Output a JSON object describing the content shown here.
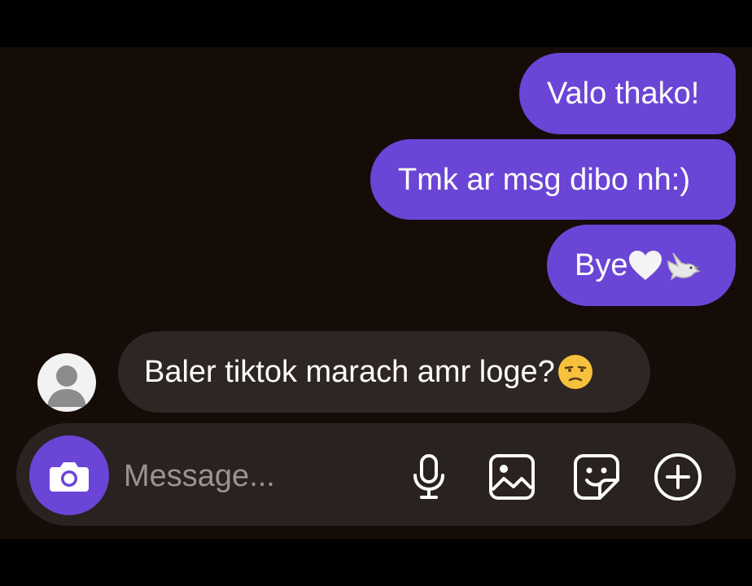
{
  "messages": {
    "outgoing": [
      {
        "text": "Valo thako!"
      },
      {
        "text": "Tmk ar msg dibo nh:)"
      },
      {
        "text": "Bye"
      }
    ],
    "incoming": [
      {
        "text": "Baler tiktok marach amr loge?"
      }
    ]
  },
  "composer": {
    "placeholder": "Message..."
  },
  "icons": {
    "camera": "camera-icon",
    "mic": "microphone-icon",
    "gallery": "image-icon",
    "sticker": "sticker-icon",
    "more": "plus-circle-icon",
    "avatar": "default-avatar-icon"
  },
  "colors": {
    "outgoing_bubble": "#6b45d6",
    "incoming_bubble": "#2e2624",
    "background": "#150c08",
    "composer": "#2a2220"
  }
}
